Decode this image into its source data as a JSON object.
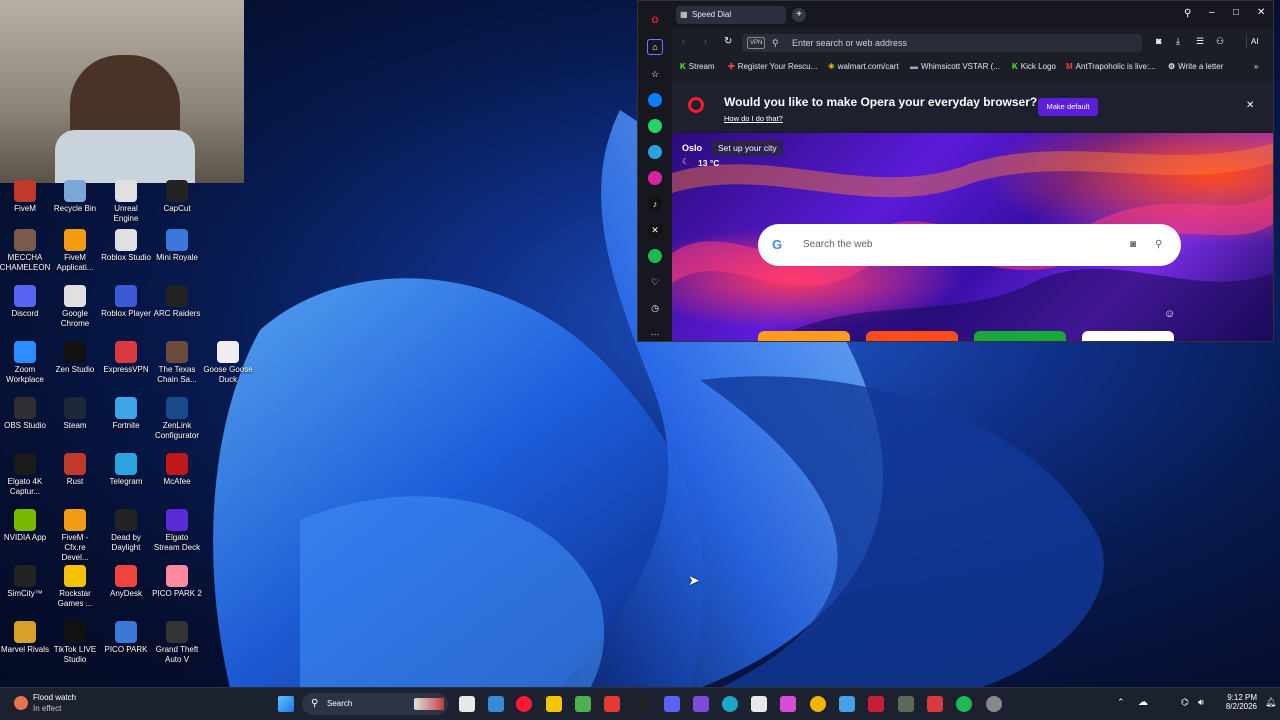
{
  "desktop": {
    "icons": [
      {
        "label": "FiveM",
        "color": "#c0392b"
      },
      {
        "label": "Recycle Bin",
        "color": "#7aa6d8"
      },
      {
        "label": "Unreal Engine",
        "color": "#e0e0e0"
      },
      {
        "label": "CapCut",
        "color": "#222"
      },
      {
        "label": "MECCHA CHAMELEON",
        "color": "#7a5a4a"
      },
      {
        "label": "FiveM Applicati...",
        "color": "#f39c12"
      },
      {
        "label": "Roblox Studio",
        "color": "#e0e0e0"
      },
      {
        "label": "Mini Royale",
        "color": "#3c78d8"
      },
      {
        "label": "Discord",
        "color": "#5865f2"
      },
      {
        "label": "Google Chrome",
        "color": "#e0e0e0"
      },
      {
        "label": "Roblox Player",
        "color": "#3a5ad8"
      },
      {
        "label": "ARC Raiders",
        "color": "#222"
      },
      {
        "label": "Zoom Workplace",
        "color": "#2d8cff"
      },
      {
        "label": "Zen Studio",
        "color": "#111"
      },
      {
        "label": "ExpressVPN",
        "color": "#da3940"
      },
      {
        "label": "The Texas Chain Sa...",
        "color": "#6b4b3a"
      },
      {
        "label": "Goose Goose Duck",
        "color": "#eee"
      },
      {
        "label": "OBS Studio",
        "color": "#302e31"
      },
      {
        "label": "Steam",
        "color": "#1b2838"
      },
      {
        "label": "Fortnite",
        "color": "#3fa4e8"
      },
      {
        "label": "ZenLink Configurator",
        "color": "#1a4a8a"
      },
      {
        "label": "Elgato 4K Captur...",
        "color": "#1a1a1a"
      },
      {
        "label": "Rust",
        "color": "#c0392b"
      },
      {
        "label": "Telegram",
        "color": "#2aa3df"
      },
      {
        "label": "McAfee",
        "color": "#c01818"
      },
      {
        "label": "NVIDIA App",
        "color": "#76b900"
      },
      {
        "label": "FiveM - Cfx.re Devel...",
        "color": "#f39c12"
      },
      {
        "label": "Dead by Daylight",
        "color": "#222"
      },
      {
        "label": "Elgato Stream Deck",
        "color": "#5a2ad8"
      },
      {
        "label": "SimCity™",
        "color": "#222"
      },
      {
        "label": "Rockstar Games ...",
        "color": "#f2c200"
      },
      {
        "label": "AnyDesk",
        "color": "#ef443b"
      },
      {
        "label": "PICO PARK 2",
        "color": "#ff8aa0"
      },
      {
        "label": "Marvel Rivals",
        "color": "#d8a02a"
      },
      {
        "label": "TikTok LIVE Studio",
        "color": "#111"
      },
      {
        "label": "PICO PARK",
        "color": "#3c78d8"
      },
      {
        "label": "Grand Theft Auto V",
        "color": "#333"
      }
    ]
  },
  "browser": {
    "tab_label": "Speed Dial",
    "address_placeholder": "Enter search or web address",
    "vpn_label": "VPN",
    "ai_label": "AI",
    "bookmarks": [
      "Stream",
      "Register Your Rescu...",
      "walmart.com/cart",
      "Whimsicott VSTAR (...",
      "Kick Logo",
      "AntTrapoholic is live:...",
      "Write a letter"
    ],
    "banner_title": "Would you like to make Opera your everyday browser?",
    "banner_link": "How do I do that?",
    "make_default": "Make default",
    "city": "Oslo",
    "city_setup": "Set up your city",
    "temperature": "13 °C",
    "google_placeholder": "Search the web"
  },
  "taskbar": {
    "weather_title": "Flood watch",
    "weather_sub": "In effect",
    "search_label": "Search",
    "time": "9:12 PM",
    "date": "8/2/2026"
  }
}
